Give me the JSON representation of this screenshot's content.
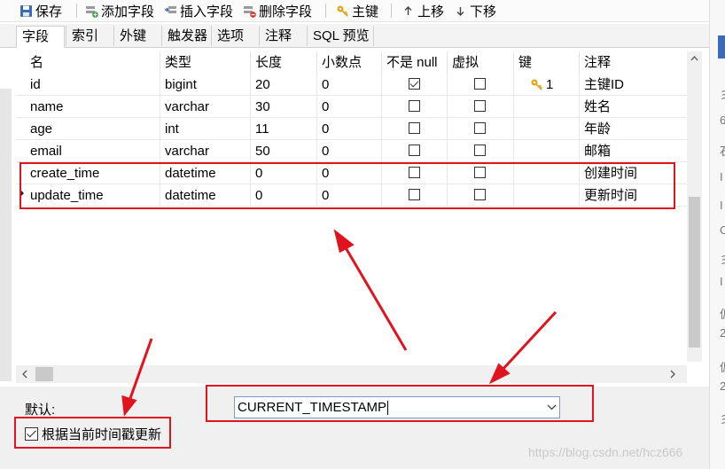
{
  "toolbar": {
    "save_label": "保存",
    "add_field_label": "添加字段",
    "insert_field_label": "插入字段",
    "delete_field_label": "删除字段",
    "primary_key_label": "主键",
    "move_up_label": "上移",
    "move_down_label": "下移"
  },
  "tabs": [
    "字段",
    "索引",
    "外键",
    "触发器",
    "选项",
    "注释",
    "SQL 预览"
  ],
  "columns": [
    "名",
    "类型",
    "长度",
    "小数点",
    "不是 null",
    "虚拟",
    "键",
    "注释"
  ],
  "rows": [
    {
      "name": "id",
      "type": "bigint",
      "length": "20",
      "decimals": "0",
      "not_null": true,
      "virtual": false,
      "key": "1",
      "comment": "主键ID"
    },
    {
      "name": "name",
      "type": "varchar",
      "length": "30",
      "decimals": "0",
      "not_null": false,
      "virtual": false,
      "key": "",
      "comment": "姓名"
    },
    {
      "name": "age",
      "type": "int",
      "length": "11",
      "decimals": "0",
      "not_null": false,
      "virtual": false,
      "key": "",
      "comment": "年龄"
    },
    {
      "name": "email",
      "type": "varchar",
      "length": "50",
      "decimals": "0",
      "not_null": false,
      "virtual": false,
      "key": "",
      "comment": "邮箱"
    },
    {
      "name": "create_time",
      "type": "datetime",
      "length": "0",
      "decimals": "0",
      "not_null": false,
      "virtual": false,
      "key": "",
      "comment": "创建时间"
    },
    {
      "name": "update_time",
      "type": "datetime",
      "length": "0",
      "decimals": "0",
      "not_null": false,
      "virtual": false,
      "key": "",
      "comment": "更新时间"
    }
  ],
  "bottom": {
    "default_label": "默认:",
    "default_value": "CURRENT_TIMESTAMP",
    "update_checkbox_label": "根据当前时间戳更新",
    "update_checkbox_checked": true
  },
  "watermark": "https://blog.csdn.net/hcz666",
  "right_panel_chars": [
    "彡",
    "6",
    "石",
    "I",
    "I",
    "C",
    "彡",
    "I",
    "仮",
    "2",
    "仮",
    "2",
    "彡"
  ],
  "colors": {
    "annotation_red": "#e0141e",
    "key_gold": "#e0a818"
  }
}
